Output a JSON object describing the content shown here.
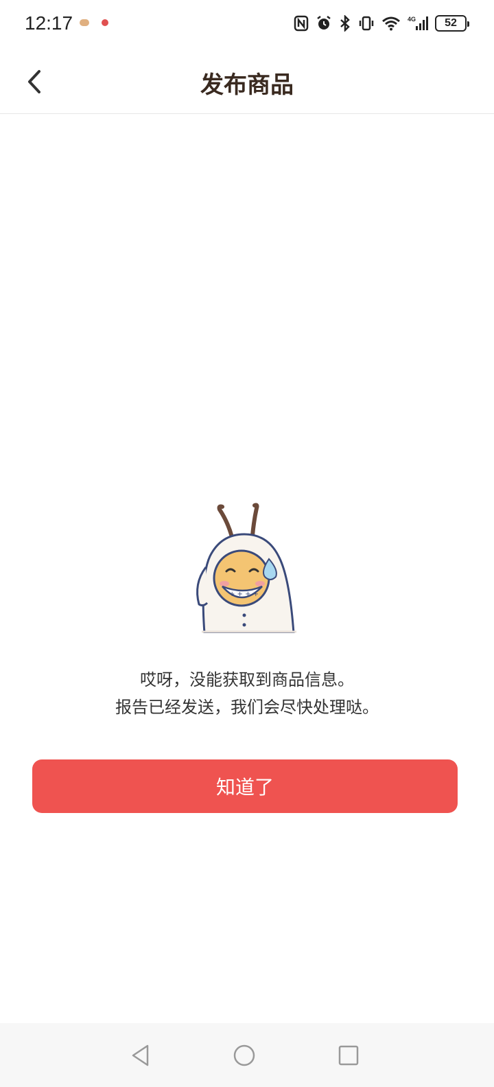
{
  "status_bar": {
    "time": "12:17",
    "battery": "52",
    "icons": [
      "nfc-icon",
      "alarm-icon",
      "bluetooth-icon",
      "vibrate-icon",
      "wifi-icon",
      "signal-4g-icon",
      "battery-icon"
    ]
  },
  "header": {
    "title": "发布商品",
    "back_icon": "chevron-left-icon"
  },
  "content": {
    "message_line_1": "哎呀，没能获取到商品信息。",
    "message_line_2": "报告已经发送，我们会尽快处理哒。",
    "button_label": "知道了"
  },
  "colors": {
    "accent": "#ef5350",
    "title": "#3a2a20",
    "text": "#333333"
  },
  "nav_bar": {
    "icons": [
      "back-triangle-icon",
      "home-circle-icon",
      "recents-square-icon"
    ]
  }
}
